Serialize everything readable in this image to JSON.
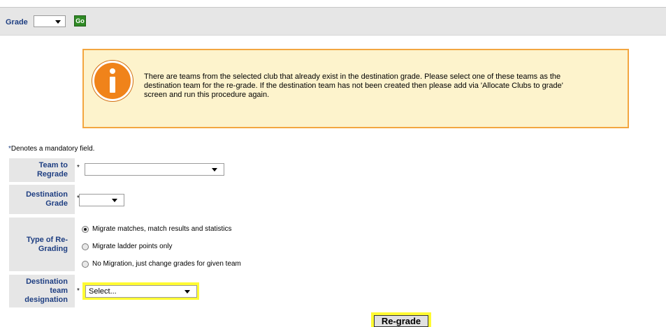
{
  "grade_bar": {
    "label": "Grade",
    "selected_value": "",
    "go_label": "Go"
  },
  "info": {
    "icon": "info-icon",
    "message": "There are teams from the selected club that already exist in the destination grade. Please select one of these teams as the destination team for the re-grade. If the destination team has not been created then please add via 'Allocate Clubs to grade' screen and run this procedure again."
  },
  "mandatory_note": {
    "star": "*",
    "text": "Denotes a mandatory field."
  },
  "form": {
    "team_to_regrade": {
      "label": "Team to Regrade",
      "required": "*",
      "value": ""
    },
    "destination_grade": {
      "label": "Destination Grade",
      "required": "*",
      "value": ""
    },
    "type_of_regrading": {
      "label": "Type of Re-Grading",
      "options": [
        {
          "label": "Migrate matches, match results and statistics",
          "checked": true
        },
        {
          "label": "Migrate ladder points only",
          "checked": false
        },
        {
          "label": "No Migration, just change grades for given team",
          "checked": false
        }
      ]
    },
    "destination_team": {
      "label": "Destination team designation",
      "required": "*",
      "value": "Select..."
    }
  },
  "regrade_button": {
    "label": "Re-grade"
  },
  "colors": {
    "label_text": "#1f3f82",
    "info_border": "#f3a640",
    "info_bg": "#fdf3cc",
    "highlight": "#fffb32",
    "go_button": "#2f8a25"
  }
}
